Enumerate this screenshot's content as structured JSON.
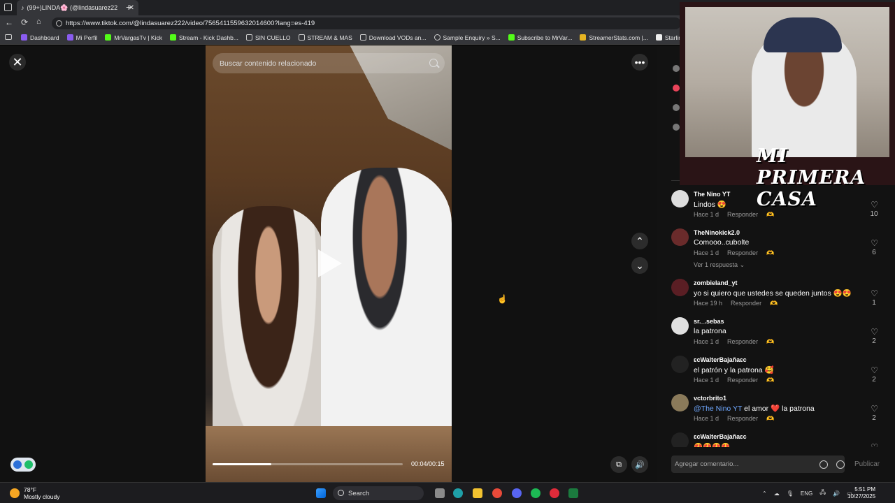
{
  "browser": {
    "tab_title": "(99+)LINDA🌸 (@lindasuarez22",
    "new_tab": "+",
    "url": "https://www.tiktok.com/@lindasuarez222/video/7565411559632014600?lang=es-419",
    "bookmarks": [
      "Dashboard",
      "Mi Perfil",
      "MrVargasTv | Kick",
      "Stream - Kick Dashb...",
      "SIN CUELLO",
      "STREAM & MAS",
      "Download VODs an...",
      "Sample Enquiry » S...",
      "Subscribe to MrVar...",
      "StreamerStats.com |...",
      "Starlink Battery Pow..."
    ]
  },
  "player": {
    "search_placeholder": "Buscar contenido relacionado",
    "timecode": "00:04/00:15",
    "progress": 0.31
  },
  "comments": [
    {
      "user": "The Nino YT",
      "text": "Lindos 😍",
      "time": "Hace 1 d",
      "reply": "Responder",
      "likes": "10",
      "replies": ""
    },
    {
      "user": "TheNinokick2.0",
      "text": "Comooo..cubolte",
      "time": "Hace 1 d",
      "reply": "Responder",
      "likes": "6",
      "replies": "Ver 1 respuesta"
    },
    {
      "user": "zombieland_yt",
      "text": "yo si quiero que ustedes se queden juntos 😍😍",
      "time": "Hace 19 h",
      "reply": "Responder",
      "likes": "1",
      "replies": ""
    },
    {
      "user": "sr._.sebas",
      "text": "la patrona",
      "time": "Hace 1 d",
      "reply": "Responder",
      "likes": "2",
      "replies": ""
    },
    {
      "user": "ɛcWalterBajañaɛc",
      "text": "el patrón y la patrona 🥰",
      "time": "Hace 1 d",
      "reply": "Responder",
      "likes": "2",
      "replies": ""
    },
    {
      "user": "vctorbrito1",
      "mention": "@The Nino YT",
      "text": " el amor ❤️ la patrona",
      "time": "Hace 1 d",
      "reply": "Responder",
      "likes": "2",
      "replies": ""
    },
    {
      "user": "ɛcWalterBajañaɛc",
      "text": "😍😍😍😍",
      "time": "",
      "reply": "",
      "likes": "",
      "replies": ""
    }
  ],
  "comment_box": {
    "placeholder": "Agregar comentario...",
    "publish": "Publicar"
  },
  "overlay": {
    "logo": "MI PRIMERA CASA"
  },
  "taskbar": {
    "temp": "78°F",
    "condition": "Mostly cloudy",
    "search": "Search",
    "lang": "ENG",
    "time": "5:51 PM",
    "date": "10/27/2025"
  },
  "colors": {
    "accent": "#2b6fd8",
    "mention": "#6fa8ff"
  }
}
